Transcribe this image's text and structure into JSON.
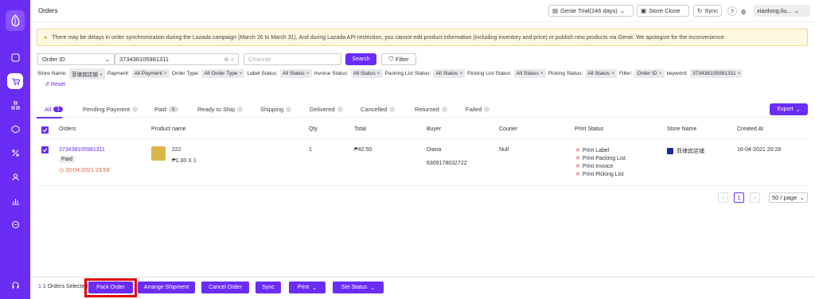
{
  "header": {
    "title": "Orders",
    "trial": "Genie Trial(246 days)",
    "store_clone": "Store Clone",
    "sync": "Sync",
    "help": "?",
    "user": "xiaolong.liu..."
  },
  "warning": "There may be delays in order synchronization during the Lazada campaign (March 26 to March 31), And during Lazada API restriction, you cannot edit product information (including inventory and price) or publish new products via Genie. We apologize for the inconvenience",
  "search": {
    "field": "Order ID",
    "value": "373438105981311",
    "channel_placeholder": "Channel",
    "search_label": "Search",
    "filter_label": "Filter"
  },
  "filters": [
    {
      "label": "Store Name:",
      "value": "菲律宾店铺"
    },
    {
      "label": "Payment:",
      "value": "All Payment"
    },
    {
      "label": "Order Type:",
      "value": "All Order Type"
    },
    {
      "label": "Label Status:",
      "value": "All Status"
    },
    {
      "label": "Invoice Status:",
      "value": "All Status"
    },
    {
      "label": "Packing List Status:",
      "value": "All Status"
    },
    {
      "label": "Picking List Status:",
      "value": "All Status"
    },
    {
      "label": "Picking Status:",
      "value": "All Status"
    },
    {
      "label": "Filter:",
      "value": "Order ID"
    },
    {
      "label": "keyword:",
      "value": "373438105981311"
    }
  ],
  "reset": "Reset",
  "tabs": [
    {
      "label": "All",
      "count": "1"
    },
    {
      "label": "Pending Payment"
    },
    {
      "label": "Paid",
      "count": "1"
    },
    {
      "label": "Ready to Ship"
    },
    {
      "label": "Shipping"
    },
    {
      "label": "Delivered"
    },
    {
      "label": "Cancelled"
    },
    {
      "label": "Returned"
    },
    {
      "label": "Failed"
    }
  ],
  "export": "Export",
  "columns": [
    "Orders",
    "Product name",
    "Qty",
    "Total",
    "Buyer",
    "Courier",
    "Print Status",
    "Store Name",
    "Created At"
  ],
  "order": {
    "id": "373438105981311",
    "status": "Paid",
    "deadline": "20-04-2021 23:59",
    "product": "222",
    "price": "₱1.00 X 1",
    "qty": "1",
    "total": "₱42.50",
    "buyer": "Diana",
    "phone": "6309178032722",
    "courier": "Null",
    "print_status": [
      "Print Label",
      "Print Packing List",
      "Print Invoice",
      "Print Picking List"
    ],
    "store": "菲律宾店铺",
    "created": "16-04-2021 20:28"
  },
  "pagination": {
    "page": "1",
    "per_page": "50 / page"
  },
  "bottom": {
    "selected": "1 Orders Selected",
    "pack": "Pack Order",
    "arrange": "Arrange Shipment",
    "cancel": "Cancel Order",
    "sync": "Sync",
    "print": "Print",
    "set_status": "Set Status"
  },
  "colors": {
    "primary": "#6b2cf5",
    "highlight": "#e00000"
  }
}
